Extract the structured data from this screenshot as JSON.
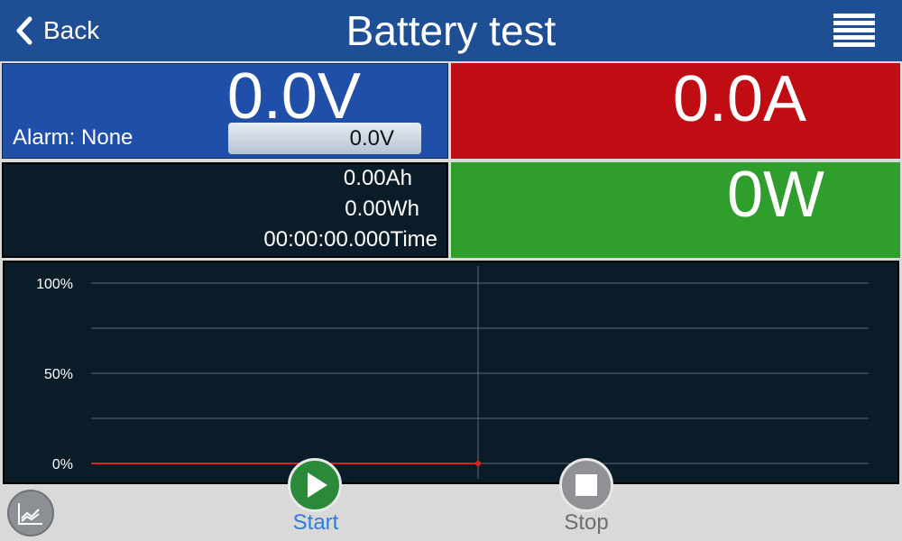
{
  "header": {
    "back_label": "Back",
    "title": "Battery test",
    "back_icon": "chevron-left-icon",
    "menu_icon": "hamburger-menu-icon"
  },
  "voltage": {
    "value": "0.0V",
    "alarm": "Alarm: None",
    "setpoint": "0.0V",
    "color": "#1f4fa8"
  },
  "current": {
    "value": "0.0A",
    "color": "#c00d14"
  },
  "power": {
    "value": "0W",
    "color": "#2f9e2d"
  },
  "stats": {
    "capacity": "0.00Ah",
    "energy": "0.00Wh",
    "time": "00:00:00.000Time"
  },
  "chart_data": {
    "type": "line",
    "y_ticks": [
      "100%",
      "50%",
      "0%"
    ],
    "ylim": [
      0,
      100
    ],
    "grid": true,
    "series": [
      {
        "values": [
          0,
          0
        ],
        "color": "#e02020"
      }
    ]
  },
  "buttons": {
    "start_label": "Start",
    "stop_label": "Stop",
    "graph_icon": "graph-view-icon",
    "start_icon": "play-icon",
    "stop_icon": "stop-icon"
  }
}
